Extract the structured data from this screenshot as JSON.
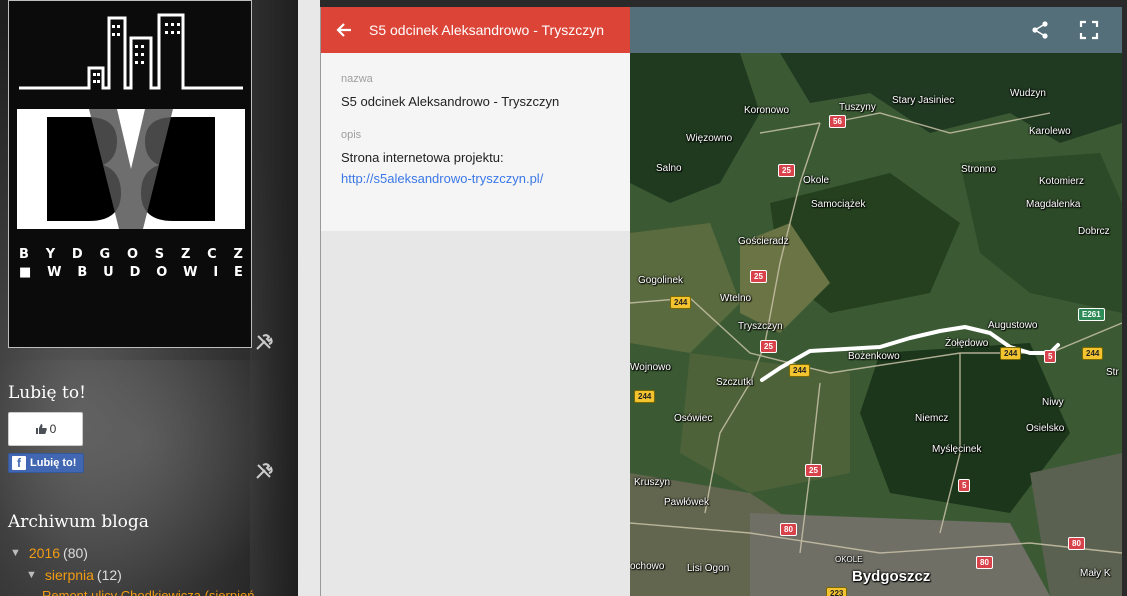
{
  "blog": {
    "logo": {
      "line1": [
        "B",
        "Y",
        "D",
        "G",
        "O",
        "S",
        "Z",
        "C",
        "Z"
      ],
      "line2": [
        "■",
        "W",
        "B",
        "U",
        "D",
        "O",
        "W",
        "I",
        "E"
      ]
    },
    "like_widget": {
      "title": "Lubię to!",
      "count": "0",
      "fb_button_label": "Lubię to!",
      "fb_icon_letter": "f"
    },
    "archive": {
      "title": "Archiwum bloga",
      "year": {
        "expander": "▼",
        "label": "2016",
        "count": "(80)"
      },
      "month": {
        "expander": "▼",
        "label": "sierpnia",
        "count": "(12)"
      },
      "post_fragment": "Remont ulicy Chodkiewicza (sierpień"
    }
  },
  "map": {
    "info_title": "S5 odcinek Aleksandrowo - Tryszczyn",
    "name_label": "nazwa",
    "name_value": "S5 odcinek Aleksandrowo - Tryszczyn",
    "desc_label": "opis",
    "desc_text": "Strona internetowa projektu: ",
    "desc_link": "http://s5aleksandrowo-tryszczyn.pl/",
    "colors": {
      "info_header": "#db4437",
      "map_header": "#546e7a",
      "route": "#ffffff",
      "link": "#3b78e7"
    },
    "icons": [
      "back-arrow-icon",
      "share-icon",
      "fullscreen-icon"
    ],
    "places": {
      "koronowo": "Koronowo",
      "tuszyny": "Tuszyny",
      "stary_jasiniec": "Stary Jasiniec",
      "wudzyn": "Wudzyn",
      "wiezowno": "Więzowno",
      "karolewo": "Karolewo",
      "salno": "Salno",
      "okole": "Okole",
      "stronno": "Stronno",
      "kotomierz": "Kotomierz",
      "samociazek": "Samociążek",
      "magdalenka": "Magdalenka",
      "goscieradz": "Gościeradz",
      "dobrcz": "Dobrcz",
      "gogolinek": "Gogolinek",
      "wtelno": "Wtelno",
      "tryszczyn": "Tryszczyn",
      "augustowo": "Augustowo",
      "zoledowo": "Żołędowo",
      "bozenkowo": "Bożenkowo",
      "wojnowo": "Wojnowo",
      "szczutki": "Szczutki",
      "str": "Str",
      "osowiec": "Osówiec",
      "niemcz": "Niemcz",
      "niwy": "Niwy",
      "osielsko": "Osielsko",
      "myslecinek": "Myślęcinek",
      "kruszyn": "Kruszyn",
      "pawlowek": "Pawłówek",
      "lisi_ogon": "Lisi Ogon",
      "okole_city": "OKOLE",
      "bydgoszcz": "Bydgoszcz",
      "maly_k": "Mały K",
      "ochowo": "ochowo"
    },
    "road_numbers": {
      "r56": "56",
      "r25a": "25",
      "r25b": "25",
      "r25c": "25",
      "r25d": "25",
      "r244a": "244",
      "r244b": "244",
      "r244c": "244",
      "r244d": "244",
      "r244e": "244",
      "r5a": "5",
      "r5b": "5",
      "r80a": "80",
      "r80b": "80",
      "r80c": "80",
      "e261": "E261",
      "r223": "223"
    }
  }
}
